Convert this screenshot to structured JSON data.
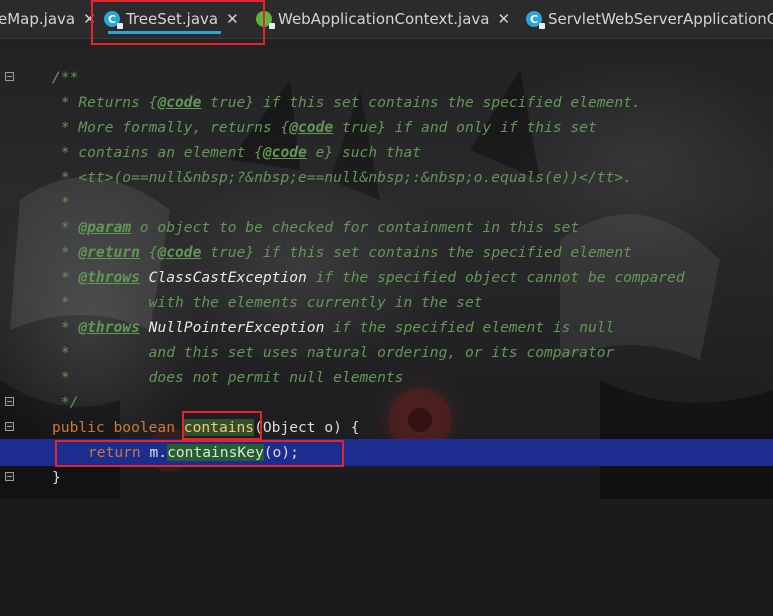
{
  "tabs": [
    {
      "label": "eMap.java",
      "icon": "none",
      "active": false
    },
    {
      "label": "TreeSet.java",
      "icon": "class-icon",
      "active": true
    },
    {
      "label": "WebApplicationContext.java",
      "icon": "interface-icon",
      "active": false
    },
    {
      "label": "ServletWebServerApplicationCo",
      "icon": "class-icon",
      "active": false
    }
  ],
  "tab_close_glyph": "✕",
  "icon_letters": {
    "class": "C",
    "interface": "I"
  },
  "code": {
    "l1": "/**",
    "l2_a": " * Returns {",
    "l2_tag": "@code",
    "l2_b": " true} if this set contains the specified element.",
    "l3_a": " * More formally, returns {",
    "l3_tag": "@code",
    "l3_b": " true} if and only if this set",
    "l4_a": " * contains an element {",
    "l4_tag": "@code",
    "l4_b": " e} such that",
    "l5_a": " * ",
    "l5_b": "<tt>(o==null&nbsp;?&nbsp;e==null&nbsp;:&nbsp;o.equals(e))</tt>.",
    "l6": " *",
    "l7_a": " * ",
    "l7_tag": "@param",
    "l7_b": " o object to be checked for containment in this set",
    "l8_a": " * ",
    "l8_tag": "@return",
    "l8_b": " {",
    "l8_tag2": "@code",
    "l8_c": " true} if this set contains the specified element",
    "l9_a": " * ",
    "l9_tag": "@throws",
    "l9_cls": " ClassCastException",
    "l9_b": " if the specified object cannot be compared",
    "l10": " *         with the elements currently in the set",
    "l11_a": " * ",
    "l11_tag": "@throws",
    "l11_cls": " NullPointerException",
    "l11_b": " if the specified element is null",
    "l12": " *         and this set uses natural ordering, or its comparator",
    "l13": " *         does not permit null elements",
    "l14": " */",
    "l15_kw": "public boolean ",
    "l15_fn": "contains",
    "l15_b": "(Object o) {",
    "l16_kw": "return ",
    "l16_a": "m.",
    "l16_fn": "containsKey",
    "l16_b": "(o);",
    "l17": "}"
  },
  "colors": {
    "comment": "#629755",
    "keyword": "#cc7832",
    "method": "#ffc66d",
    "highlight_line": "#1c2d8f",
    "red_box": "#e0252c",
    "tab_accent": "#2aa8d3"
  }
}
